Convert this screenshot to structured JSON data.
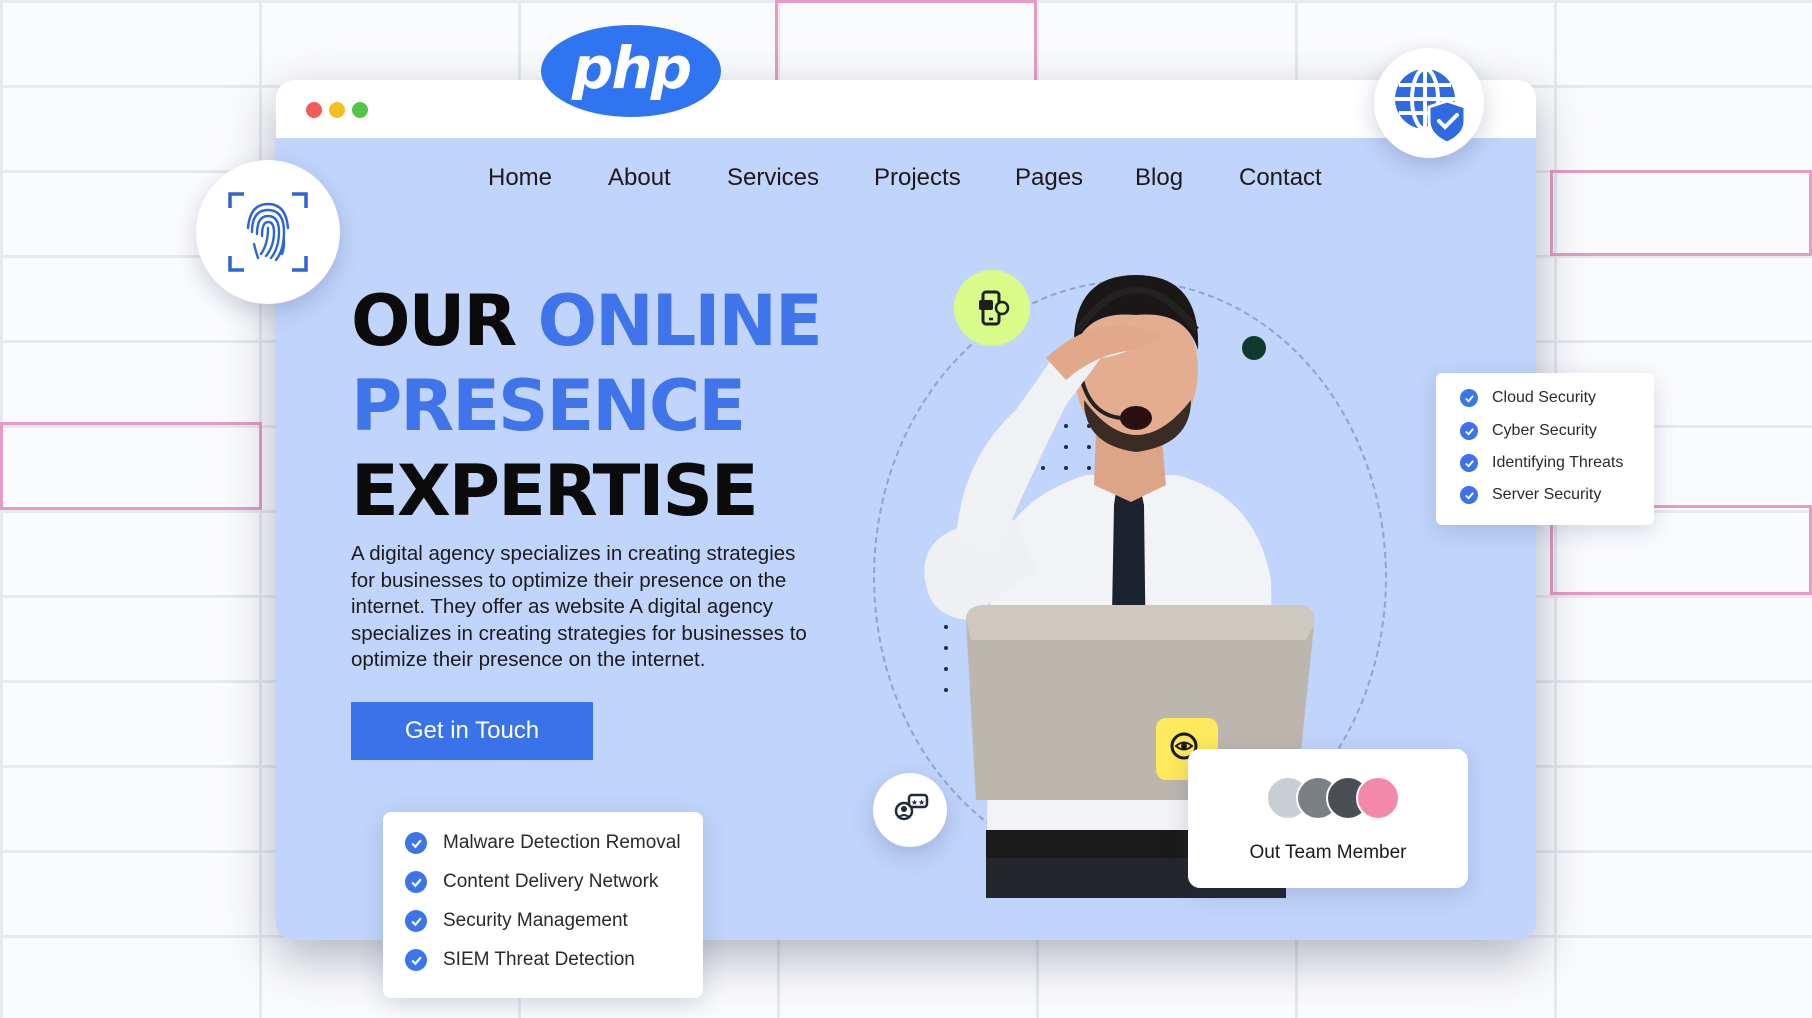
{
  "window": {
    "dots": [
      "#f15b58",
      "#f4c020",
      "#54c447"
    ]
  },
  "logo": {
    "text": "php"
  },
  "nav": {
    "items": [
      {
        "label": "Home"
      },
      {
        "label": "About"
      },
      {
        "label": "Services"
      },
      {
        "label": "Projects"
      },
      {
        "label": "Pages"
      },
      {
        "label": "Blog"
      },
      {
        "label": "Contact"
      }
    ]
  },
  "hero": {
    "line1_dark": "OUR",
    "line1_blue": "ONLINE",
    "line2_blue": "PRESENCE",
    "line3_dark": "EXPERTISE",
    "description": "A digital agency specializes in creating strategies for businesses to optimize their presence on the internet. They offer as website A digital agency specializes in creating strategies for businesses to optimize their presence on the internet.",
    "cta_label": "Get in Touch"
  },
  "security_card": {
    "items": [
      "Cloud Security",
      "Cyber Security",
      "Identifying Threats",
      "Server Security"
    ]
  },
  "services_card": {
    "items": [
      "Malware Detection Removal",
      "Content Delivery Network",
      "Security Management",
      "SIEM Threat Detection"
    ]
  },
  "team_card": {
    "label": "Out Team Member"
  },
  "icons": {
    "fingerprint": "fingerprint-icon",
    "globe": "globe-shield-icon",
    "phone": "phone-share-icon",
    "review": "user-review-icon",
    "search": "search-eye-icon"
  },
  "colors": {
    "accent": "#3f74ea",
    "window_bg": "#c1d4fb",
    "highlight_green": "#d8fb8a",
    "highlight_yellow": "#ffe95c"
  }
}
